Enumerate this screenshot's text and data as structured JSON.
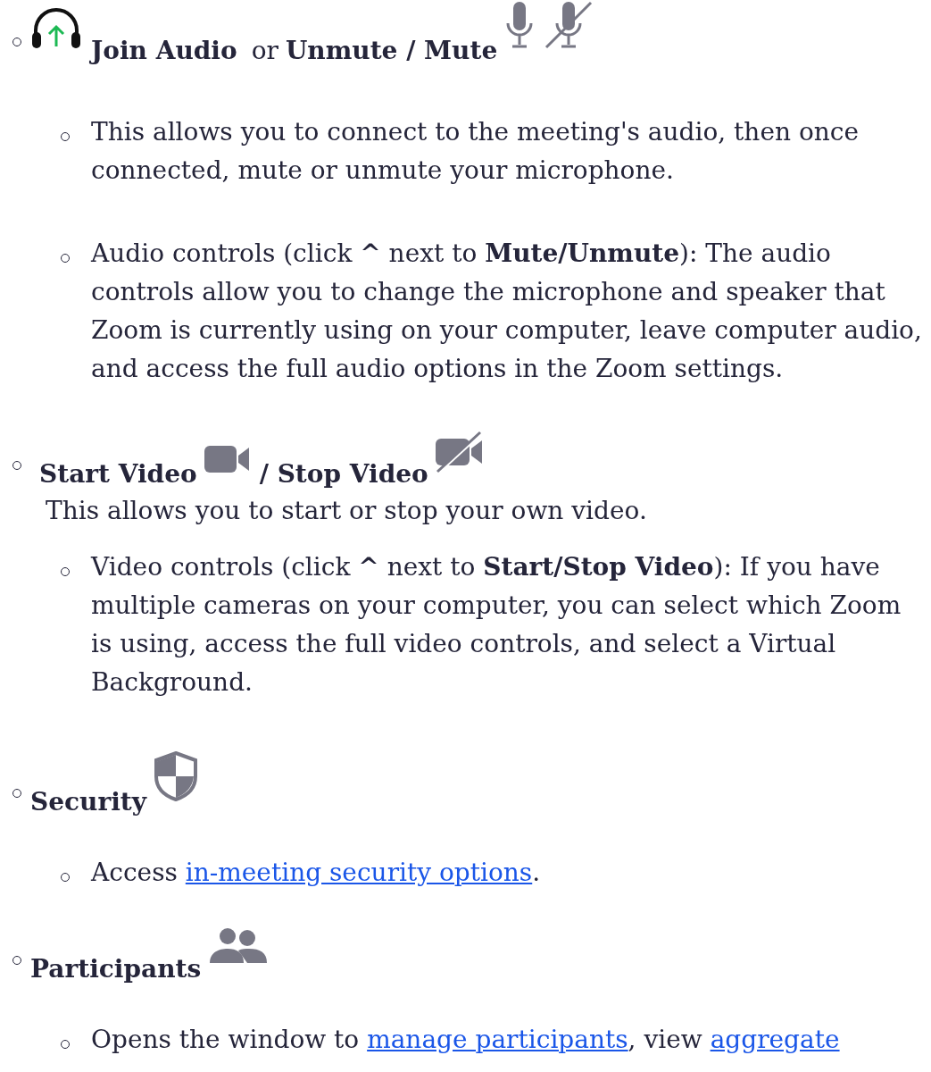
{
  "sections": [
    {
      "heading": [
        {
          "kind": "headphones"
        },
        {
          "kind": "text",
          "text": "Join Audio"
        },
        {
          "kind": "plain",
          "text": "or"
        },
        {
          "kind": "text",
          "text": "Unmute / Mute"
        },
        {
          "kind": "mic"
        },
        {
          "kind": "mic-off"
        }
      ],
      "items": [
        [
          {
            "kind": "text",
            "text": "This allows you to connect to the meeting's audio, then once connected, mute or unmute your microphone."
          }
        ],
        [
          {
            "kind": "text",
            "text": "Audio controls (click **^** next to **Mute/Unmute**): The audio controls allow you to change the microphone and speaker that Zoom is currently using on your computer, leave computer audio, and access the full audio options in the Zoom settings."
          }
        ]
      ]
    },
    {
      "heading": [
        {
          "kind": "text",
          "text": "Start Video"
        },
        {
          "kind": "camera"
        },
        {
          "kind": "text",
          "text": "/ Stop Video"
        },
        {
          "kind": "camera-off"
        }
      ],
      "note": "This allows you to start or stop your own video.",
      "items": [
        [
          {
            "kind": "text",
            "text": "Video controls (click **^** next to **Start/Stop Video**): If you have multiple cameras on your computer, you can select which Zoom is using, access the full video controls, and select a Virtual Background."
          }
        ]
      ]
    },
    {
      "heading": [
        {
          "kind": "text",
          "text": "Security"
        },
        {
          "kind": "shield"
        }
      ],
      "items": [
        [
          {
            "kind": "text",
            "text": "Access "
          },
          {
            "kind": "link",
            "text": "in-meeting security options"
          },
          {
            "kind": "text",
            "text": "."
          }
        ]
      ]
    },
    {
      "heading": [
        {
          "kind": "text",
          "text": "Participants"
        },
        {
          "kind": "people"
        }
      ],
      "items": [
        [
          {
            "kind": "text",
            "text": "Opens the window to "
          },
          {
            "kind": "link",
            "text": "manage participants"
          },
          {
            "kind": "text",
            "text": ", view "
          },
          {
            "kind": "link",
            "text": "aggregate"
          }
        ]
      ]
    }
  ]
}
